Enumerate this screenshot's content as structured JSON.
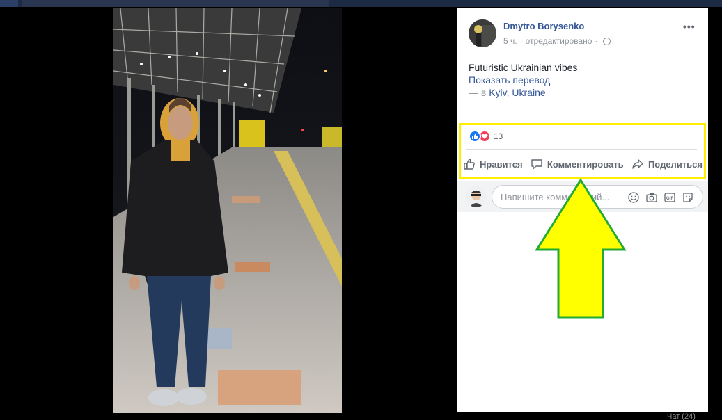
{
  "post": {
    "author": "Dmytro Borysenko",
    "time": "5 ч.",
    "edited": "отредактировано",
    "separator": "·",
    "text": "Futuristic Ukrainian vibes",
    "translate_link": "Показать перевод",
    "location_prefix": "— в",
    "location": "Kyiv, Ukraine",
    "more_label": "•••"
  },
  "reactions": {
    "count": "13",
    "types": [
      "like",
      "love"
    ]
  },
  "actions": {
    "like": "Нравится",
    "comment": "Комментировать",
    "share": "Поделиться"
  },
  "comment_box": {
    "placeholder": "Напишите комментарий..."
  },
  "colors": {
    "link": "#365899",
    "highlight": "#ffee00",
    "arrow_fill": "#ffff00",
    "arrow_stroke": "#22aa33"
  },
  "bottom": {
    "label": "Чат (24)"
  }
}
